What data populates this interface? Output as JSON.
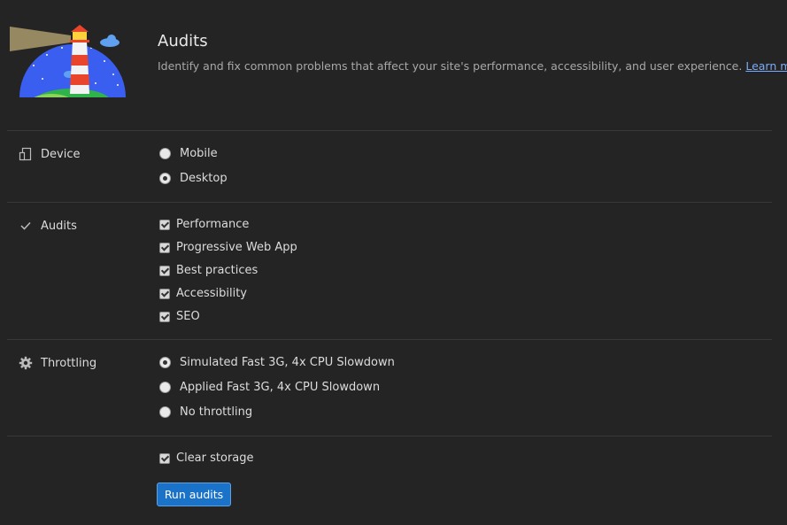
{
  "header": {
    "title": "Audits",
    "description": "Identify and fix common problems that affect your site's performance, accessibility, and user experience.",
    "link_text": "Learn more",
    "logo_icon": "lighthouse-logo"
  },
  "device": {
    "label": "Device",
    "icon": "device-icon",
    "options": [
      {
        "label": "Mobile",
        "checked": false
      },
      {
        "label": "Desktop",
        "checked": true
      }
    ]
  },
  "audits": {
    "label": "Audits",
    "icon": "checkmark-icon",
    "options": [
      {
        "label": "Performance",
        "checked": true
      },
      {
        "label": "Progressive Web App",
        "checked": true
      },
      {
        "label": "Best practices",
        "checked": true
      },
      {
        "label": "Accessibility",
        "checked": true
      },
      {
        "label": "SEO",
        "checked": true
      }
    ]
  },
  "throttling": {
    "label": "Throttling",
    "icon": "gear-icon",
    "options": [
      {
        "label": "Simulated Fast 3G, 4x CPU Slowdown",
        "checked": true
      },
      {
        "label": "Applied Fast 3G, 4x CPU Slowdown",
        "checked": false
      },
      {
        "label": "No throttling",
        "checked": false
      }
    ]
  },
  "storage": {
    "label": "Clear storage",
    "checked": true
  },
  "run_button": {
    "label": "Run audits"
  },
  "colors": {
    "background": "#242424",
    "accent": "#1a73c8",
    "link": "#7cacf8"
  }
}
